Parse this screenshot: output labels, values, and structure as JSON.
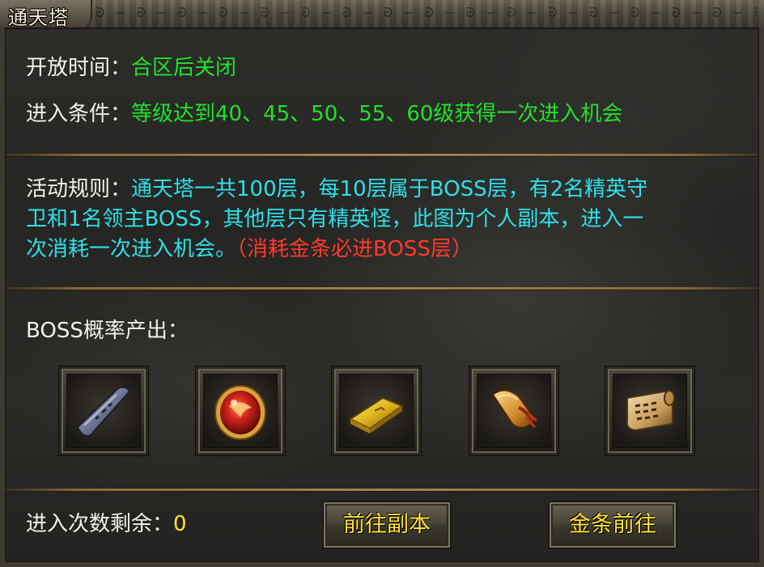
{
  "window": {
    "title": "通天塔",
    "ornament": "ᘐ ∽ ᘐ ∽ ᘐ ∽ ᘐ ∽ ᘐ ∽ ᘐ ∽ ᘐ ∽ ᘐ ∽ ᘐ ∽ ᘐ ∽ ᘐ ∽ ᘐ ∽ ᘐ ∽ ᘐ ∽ ᘐ ∽ ᘐ ∽ ᘐ ∽ ᘐ ∽ ᘐ ∽ ᘐ ∽ ᘐ ∽ ᘐ ∽ ᘐ ∽ ᘐ ∽ ᘐ ∽"
  },
  "info": {
    "open_time_label": "开放时间：",
    "open_time_value": "合区后关闭",
    "entry_label": "进入条件：",
    "entry_value": "等级达到40、45、50、55、60级获得一次进入机会"
  },
  "rules": {
    "label": "活动规则：",
    "line1": "通天塔一共100层，每10层属于BOSS层，有2名精英守",
    "line2": "卫和1名领主BOSS，其他层只有精英怪，此图为个人副本，进入一",
    "line3": "次消耗一次进入机会。",
    "warning": "（消耗金条必进BOSS层）"
  },
  "drops": {
    "label": "BOSS概率产出：",
    "items": [
      {
        "icon": "iron-scroll-icon"
      },
      {
        "icon": "red-gem-icon"
      },
      {
        "icon": "gold-bar-icon"
      },
      {
        "icon": "rolled-scroll-icon"
      },
      {
        "icon": "parchment-scroll-icon"
      }
    ]
  },
  "footer": {
    "remaining_label": "进入次数剩余：",
    "remaining_value": "0",
    "go_dungeon_button": "前往副本",
    "gold_go_button": "金条前往"
  },
  "colors": {
    "label": "#f4f1e8",
    "green": "#22e22a",
    "cyan": "#2fe0e8",
    "red": "#ff3a2a",
    "yellow": "#ffe43a",
    "divider": "#a3824a"
  }
}
